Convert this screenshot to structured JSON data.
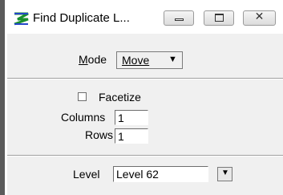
{
  "window": {
    "title": "Find Duplicate L...",
    "minimize_icon": "minimize-icon",
    "maximize_icon": "maximize-icon",
    "close_icon": "close-icon"
  },
  "mode": {
    "label_accel": "M",
    "label_rest": "ode",
    "value": "Move",
    "arrow": "▼"
  },
  "facetize": {
    "label": "Facetize",
    "checked": false
  },
  "columns": {
    "label": "Columns",
    "value": "1"
  },
  "rows": {
    "label": "Rows",
    "value": "1"
  },
  "level": {
    "label": "Level",
    "value": "Level 62",
    "arrow": "▼"
  }
}
